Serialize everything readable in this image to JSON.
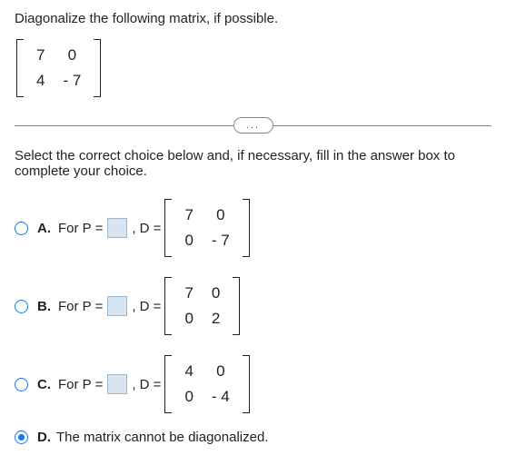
{
  "question": {
    "prompt": "Diagonalize the following matrix, if possible.",
    "matrix": {
      "r1c1": "7",
      "r1c2": "0",
      "r2c1": "4",
      "r2c2": "- 7"
    }
  },
  "ellipsis": "...",
  "instruction": "Select the correct choice below and, if necessary, fill in the answer box to complete your choice.",
  "choices": {
    "a": {
      "letter": "A.",
      "prefix": "For P =",
      "mid": ", D =",
      "matrix": {
        "r1c1": "7",
        "r1c2": "0",
        "r2c1": "0",
        "r2c2": "- 7"
      }
    },
    "b": {
      "letter": "B.",
      "prefix": "For P =",
      "mid": ", D =",
      "matrix": {
        "r1c1": "7",
        "r1c2": "0",
        "r2c1": "0",
        "r2c2": "2"
      }
    },
    "c": {
      "letter": "C.",
      "prefix": "For P =",
      "mid": ", D =",
      "matrix": {
        "r1c1": "4",
        "r1c2": "0",
        "r2c1": "0",
        "r2c2": "- 4"
      }
    },
    "d": {
      "letter": "D.",
      "text": "The matrix cannot be diagonalized."
    }
  },
  "selected": "d"
}
